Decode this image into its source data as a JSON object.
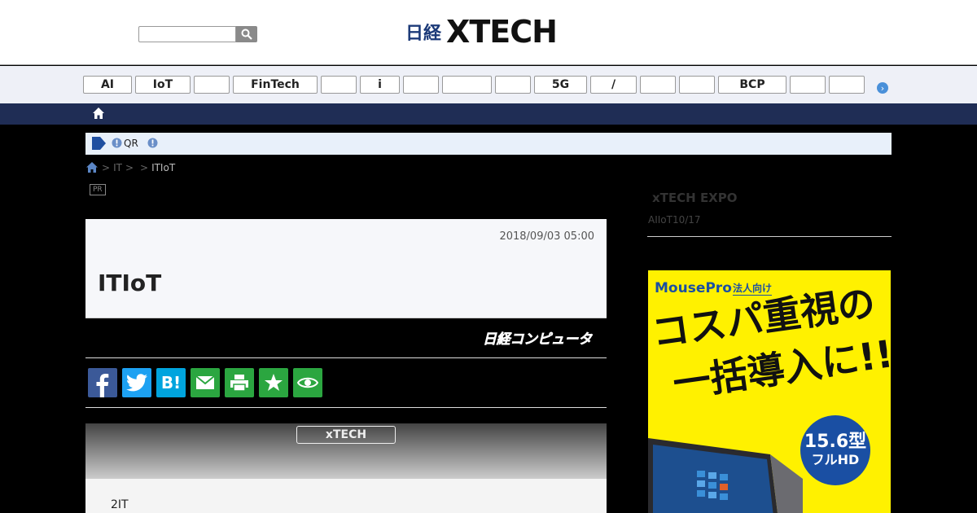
{
  "header": {
    "logo_prefix": "日経",
    "logo_main": "XTECH"
  },
  "categories": [
    "AI",
    "IoT",
    "",
    "FinTech",
    "",
    "i",
    "",
    "",
    "",
    "5G",
    "/",
    "",
    "",
    "BCP",
    "",
    ""
  ],
  "notice": {
    "qr_label": "QR"
  },
  "breadcrumb": {
    "items": [
      "IT",
      ""
    ],
    "current": "ITIoT"
  },
  "pr_badge": "PR",
  "article": {
    "date": "2018/09/03 05:00",
    "title": "ITIoT",
    "publication": "日経コンピュータ"
  },
  "share_buttons": [
    "facebook",
    "twitter",
    "hatena",
    "mail",
    "print",
    "bookmark",
    "watch"
  ],
  "gradient_button": "xTECH",
  "body_text": "2IT",
  "sidebar": {
    "expo_title": "xTECH EXPO",
    "expo_sub": "AIIoT10/17"
  },
  "ad": {
    "brand": "MousePro",
    "tag": "法人向け",
    "line1": "コスパ重視の",
    "line2": "一括導入に!!",
    "badge_size": "15.6型",
    "badge_hd": "フルHD"
  },
  "colors": {
    "nav_dark": "#1f2d55",
    "facebook": "#3b5998",
    "twitter": "#1da1f2",
    "hatena": "#00a4de",
    "green": "#2ba640",
    "ad_yellow": "#fff100",
    "ad_blue": "#1a4fa3"
  }
}
